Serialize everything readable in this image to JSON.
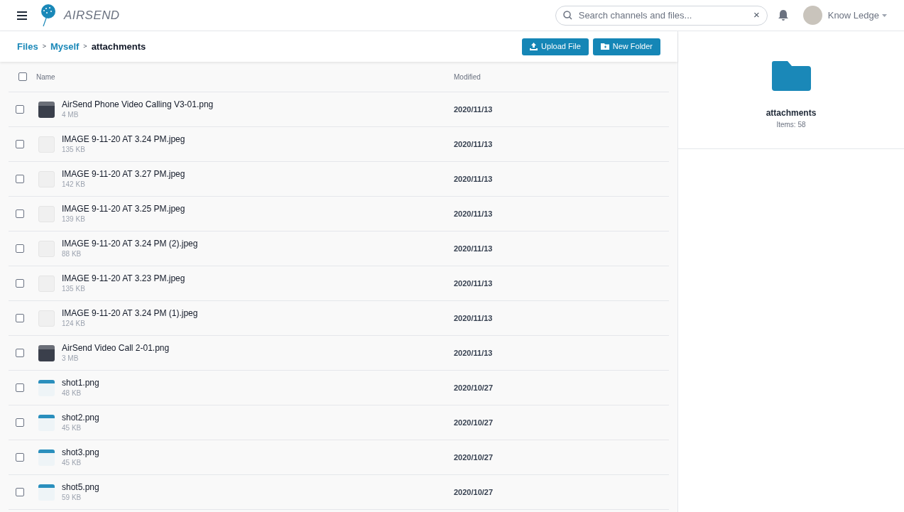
{
  "header": {
    "logo_text": "AIRSEND",
    "search": {
      "placeholder": "Search channels and files...",
      "clear": "×"
    },
    "user": {
      "name": "Know Ledge"
    }
  },
  "breadcrumb": [
    {
      "label": "Files",
      "current": false
    },
    {
      "label": "Myself",
      "current": false
    },
    {
      "label": "attachments",
      "current": true
    }
  ],
  "separator": ">",
  "buttons": [
    {
      "kind": "upload",
      "label": "Upload File"
    },
    {
      "kind": "folder",
      "label": "New Folder"
    }
  ],
  "table": {
    "columns": [
      "Name",
      "Modified"
    ],
    "select_all": false,
    "rows": [
      {
        "name": "AirSend Phone Video Calling V3-01.png",
        "size": "4 MB",
        "modified": "2020/11/13",
        "kind": "photo",
        "checked": false
      },
      {
        "name": "IMAGE 9-11-20 AT 3.24 PM.jpeg",
        "size": "135 KB",
        "modified": "2020/11/13",
        "kind": "document",
        "checked": false
      },
      {
        "name": "IMAGE 9-11-20 AT 3.27 PM.jpeg",
        "size": "142 KB",
        "modified": "2020/11/13",
        "kind": "document",
        "checked": false
      },
      {
        "name": "IMAGE 9-11-20 AT 3.25 PM.jpeg",
        "size": "139 KB",
        "modified": "2020/11/13",
        "kind": "document",
        "checked": false
      },
      {
        "name": "IMAGE 9-11-20 AT 3.24 PM (2).jpeg",
        "size": "88 KB",
        "modified": "2020/11/13",
        "kind": "document",
        "checked": false
      },
      {
        "name": "IMAGE 9-11-20 AT 3.23 PM.jpeg",
        "size": "135 KB",
        "modified": "2020/11/13",
        "kind": "document",
        "checked": false
      },
      {
        "name": "IMAGE 9-11-20 AT 3.24 PM (1).jpeg",
        "size": "124 KB",
        "modified": "2020/11/13",
        "kind": "document",
        "checked": false
      },
      {
        "name": "AirSend Video Call 2-01.png",
        "size": "3 MB",
        "modified": "2020/11/13",
        "kind": "photo",
        "checked": false
      },
      {
        "name": "shot1.png",
        "size": "48 KB",
        "modified": "2020/10/27",
        "kind": "screenshot",
        "checked": false
      },
      {
        "name": "shot2.png",
        "size": "45 KB",
        "modified": "2020/10/27",
        "kind": "screenshot",
        "checked": false
      },
      {
        "name": "shot3.png",
        "size": "45 KB",
        "modified": "2020/10/27",
        "kind": "screenshot",
        "checked": false
      },
      {
        "name": "shot5.png",
        "size": "59 KB",
        "modified": "2020/10/27",
        "kind": "screenshot",
        "checked": false
      }
    ]
  },
  "details": {
    "name": "attachments",
    "items": "Items: 58"
  }
}
